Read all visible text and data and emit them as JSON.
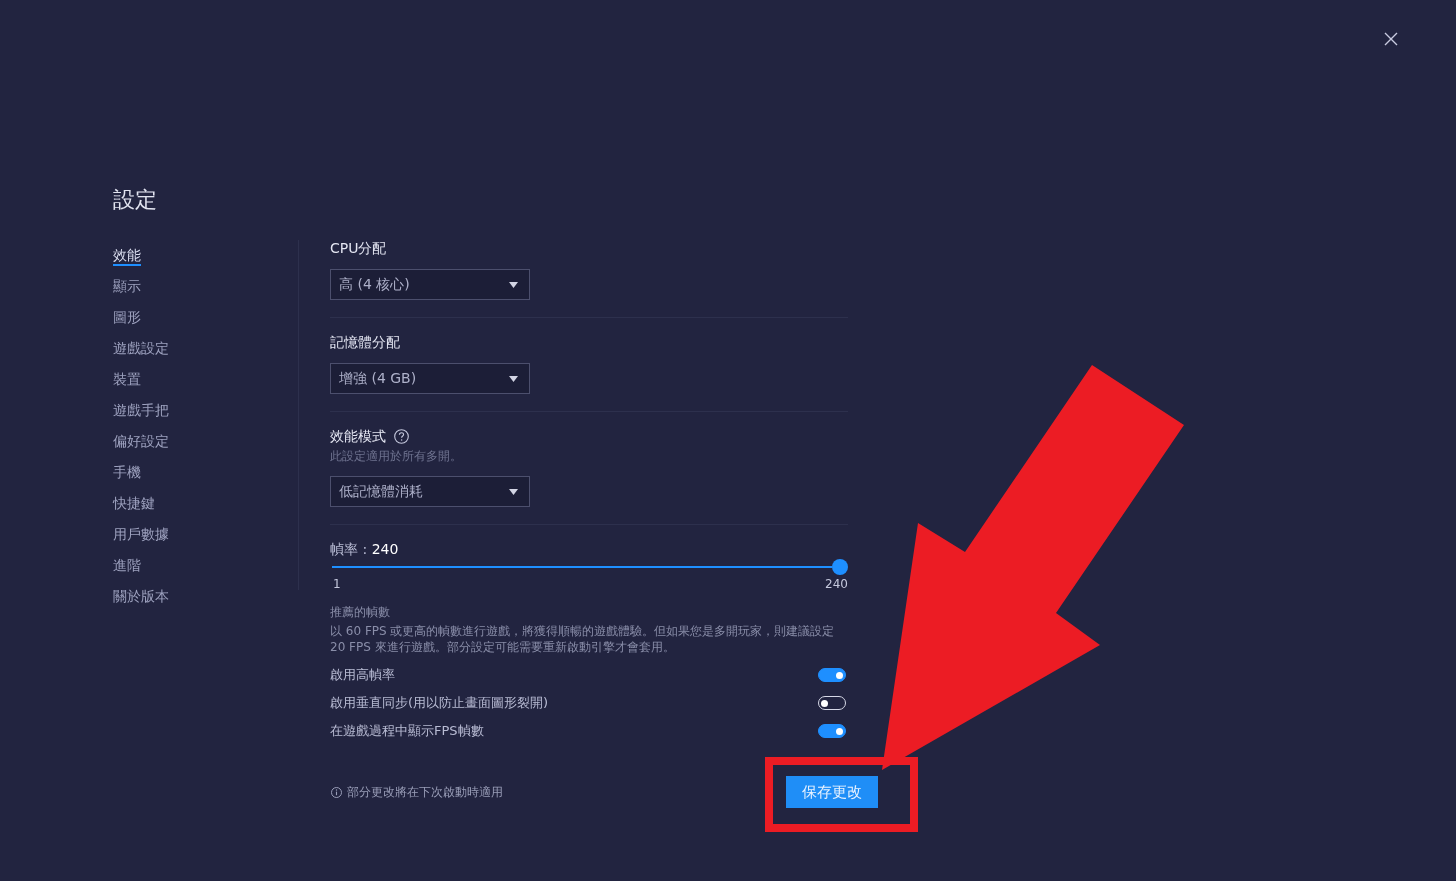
{
  "title": "設定",
  "sidebar": {
    "items": [
      {
        "label": "效能",
        "selected": true
      },
      {
        "label": "顯示",
        "selected": false
      },
      {
        "label": "圖形",
        "selected": false
      },
      {
        "label": "遊戲設定",
        "selected": false
      },
      {
        "label": "裝置",
        "selected": false
      },
      {
        "label": "遊戲手把",
        "selected": false
      },
      {
        "label": "偏好設定",
        "selected": false
      },
      {
        "label": "手機",
        "selected": false
      },
      {
        "label": "快捷鍵",
        "selected": false
      },
      {
        "label": "用戶數據",
        "selected": false
      },
      {
        "label": "進階",
        "selected": false
      },
      {
        "label": "關於版本",
        "selected": false
      }
    ]
  },
  "sections": [
    {
      "kind": "dropdown",
      "label": "CPU分配",
      "value": "高 (4 核心)"
    },
    {
      "kind": "dropdown",
      "label": "記憶體分配",
      "value": "增強 (4 GB)"
    },
    {
      "kind": "dropdown",
      "label": "效能模式",
      "help": true,
      "note": "此設定適用於所有多開。",
      "value": "低記憶體消耗"
    },
    {
      "kind": "slider",
      "label": "幀率 : **240**",
      "level": 1,
      "min_label": "1",
      "max_label": "240",
      "hint_title": "推薦的幀數",
      "hint": "以 60 FPS 或更高的幀數進行遊戲，將獲得順暢的遊戲體驗。但如果您是多開玩家，則建議設定 20 FPS 來進行遊戲。部分設定可能需要重新啟動引擎才會套用。",
      "toggles": [
        {
          "label": "啟用高幀率",
          "on": true
        },
        {
          "label": "啟用垂直同步(用以防止畫面圖形裂開)",
          "on": false
        },
        {
          "label": "在遊戲過程中顯示FPS幀數",
          "on": true
        }
      ]
    }
  ],
  "footer": {
    "note": "部分更改將在下次啟動時適用",
    "button": "保存更改"
  }
}
